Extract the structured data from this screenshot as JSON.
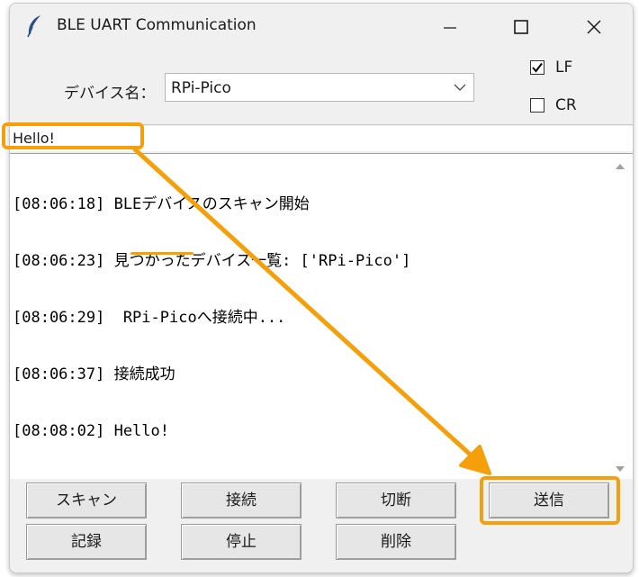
{
  "window": {
    "title": "BLE UART Communication",
    "app_icon": "feather-icon"
  },
  "device": {
    "label": "デバイス名：",
    "selected": "RPi-Pico"
  },
  "options": {
    "lf": {
      "label": "LF",
      "checked": true
    },
    "cr": {
      "label": "CR",
      "checked": false
    }
  },
  "entry": {
    "value": "Hello!"
  },
  "log": [
    "[08:06:18] BLEデバイスのスキャン開始",
    "[08:06:23] 見つかったデバイス一覧: ['RPi-Pico']",
    "[08:06:29]  RPi-Picoへ接続中...",
    "[08:06:37] 接続成功",
    "[08:08:02] Hello!"
  ],
  "buttons": {
    "scan": "スキャン",
    "connect": "接続",
    "disconnect": "切断",
    "send": "送信",
    "record": "記録",
    "stop": "停止",
    "delete": "削除"
  },
  "colors": {
    "annotation": "#f5a00a"
  }
}
